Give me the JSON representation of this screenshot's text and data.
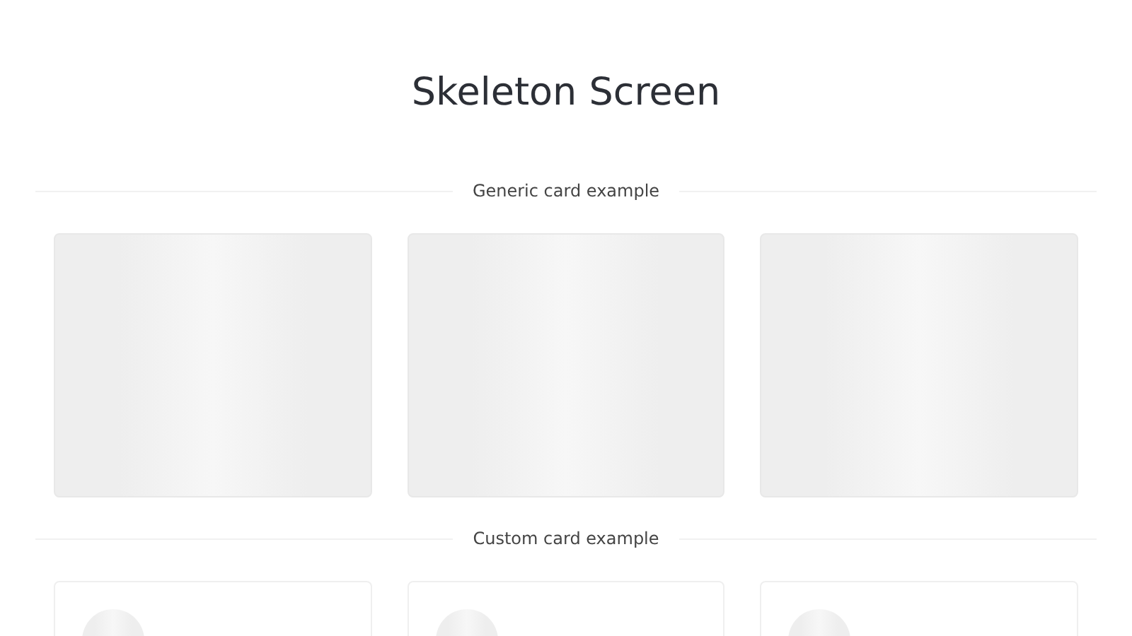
{
  "title": "Skeleton Screen",
  "sections": [
    {
      "heading": "Generic card example",
      "cards": [
        {
          "kind": "block"
        },
        {
          "kind": "block"
        },
        {
          "kind": "block"
        }
      ]
    },
    {
      "heading": "Custom card example",
      "cards": [
        {
          "kind": "avatar"
        },
        {
          "kind": "avatar"
        },
        {
          "kind": "avatar"
        }
      ]
    }
  ]
}
